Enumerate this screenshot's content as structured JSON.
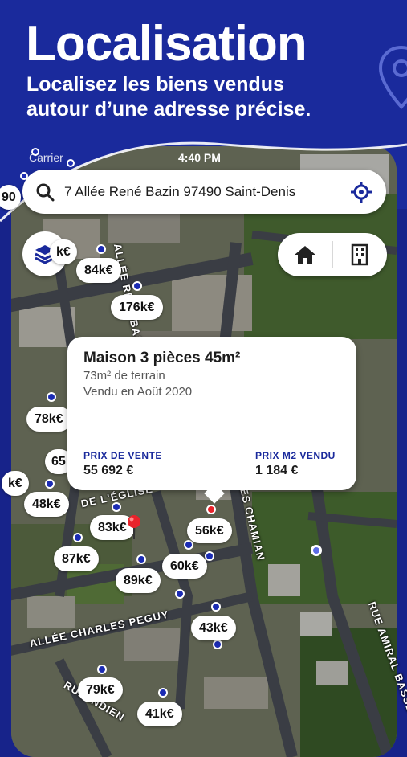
{
  "promo": {
    "title": "Localisation",
    "subtitle_line1": "Localisez les biens vendus",
    "subtitle_line2": "autour d’une adresse précise."
  },
  "status_bar": {
    "carrier": "Carrier",
    "time": "4:40 PM"
  },
  "search": {
    "address": "7 Allée René Bazin 97490 Saint-Denis",
    "icon": "search-icon",
    "locate_icon": "crosshair-icon"
  },
  "controls": {
    "layers_icon": "layers-icon",
    "house_icon": "house-icon",
    "building_icon": "building-icon"
  },
  "markers": [
    "84k€",
    "176k€",
    "78k€",
    "48k€",
    "83k€",
    "56k€",
    "87k€",
    "89k€",
    "60k€",
    "43k€",
    "79k€",
    "41k€"
  ],
  "partial_markers": [
    "k€",
    "65",
    "k€",
    "90"
  ],
  "streets": [
    "ALLÉE RENÉ BAZIN",
    "ALLÉE CHARLES PEGUY",
    "RUE AMIRAL BASSE",
    "DE L'ÉGLISE",
    "RUE INDIEN",
    "RES CHAMIAN"
  ],
  "card": {
    "title": "Maison 3 pièces 45m²",
    "line1": "73m² de terrain",
    "line2": "Vendu en Août 2020",
    "price_label": "PRIX DE VENTE",
    "price_value": "55 692 €",
    "m2_label": "PRIX M2 VENDU",
    "m2_value": "1 184 €"
  },
  "colors": {
    "brand_blue": "#1a2a9c",
    "marker_dot": "#1b2bb3",
    "selected_dot": "#e8232b"
  }
}
